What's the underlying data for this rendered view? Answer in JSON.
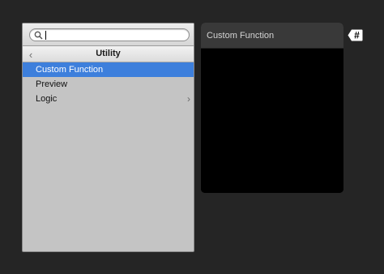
{
  "search": {
    "value": "",
    "placeholder": ""
  },
  "menu": {
    "title": "Utility",
    "items": [
      {
        "label": "Custom Function",
        "selected": true,
        "has_submenu": false
      },
      {
        "label": "Preview",
        "selected": false,
        "has_submenu": false
      },
      {
        "label": "Logic",
        "selected": false,
        "has_submenu": true
      }
    ]
  },
  "node": {
    "title": "Custom Function"
  },
  "tag": {
    "symbol": "#"
  },
  "colors": {
    "background": "#252525",
    "selection": "#3d7fdc",
    "menu_panel": "#c4c4c4",
    "node_header": "#393939",
    "node_body": "#000000"
  },
  "icons": {
    "search": "search-icon",
    "back": "chevron-left-icon",
    "submenu": "chevron-right-icon"
  }
}
